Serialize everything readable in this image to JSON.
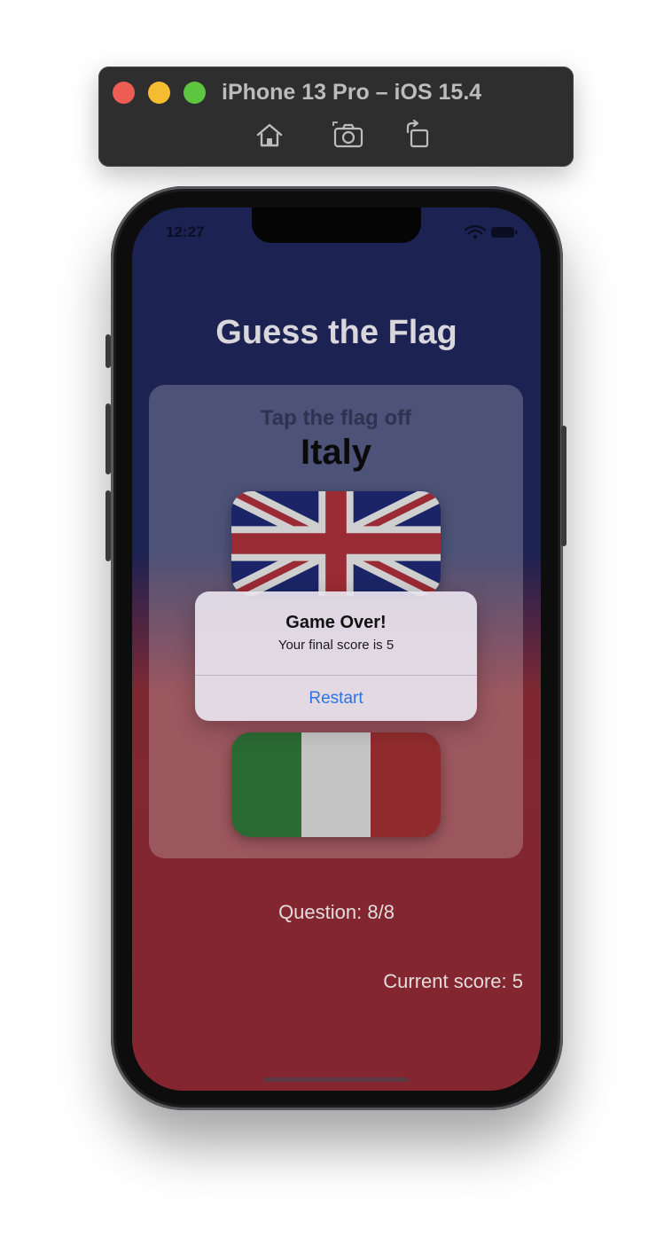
{
  "simulator": {
    "title": "iPhone 13 Pro – iOS 15.4",
    "toolbar_icons": [
      "home-icon",
      "screenshot-icon",
      "rotate-icon"
    ]
  },
  "status_bar": {
    "time": "12:27",
    "icons": [
      "wifi-icon",
      "battery-icon"
    ]
  },
  "app": {
    "title": "Guess the Flag",
    "prompt": "Tap the flag off",
    "country": "Italy",
    "flags": [
      "UK",
      "Italy"
    ],
    "question_label": "Question: 8/8",
    "score_label": "Current score: 5"
  },
  "alert": {
    "title": "Game Over!",
    "message": "Your final score is 5",
    "button": "Restart"
  },
  "colors": {
    "background_top": "#1c2252",
    "background_bottom": "#84262f",
    "alert_button": "#2d73e6",
    "italy_green": "#2a6a33",
    "italy_white": "#c4c4c4",
    "italy_red": "#8f2b2d"
  }
}
